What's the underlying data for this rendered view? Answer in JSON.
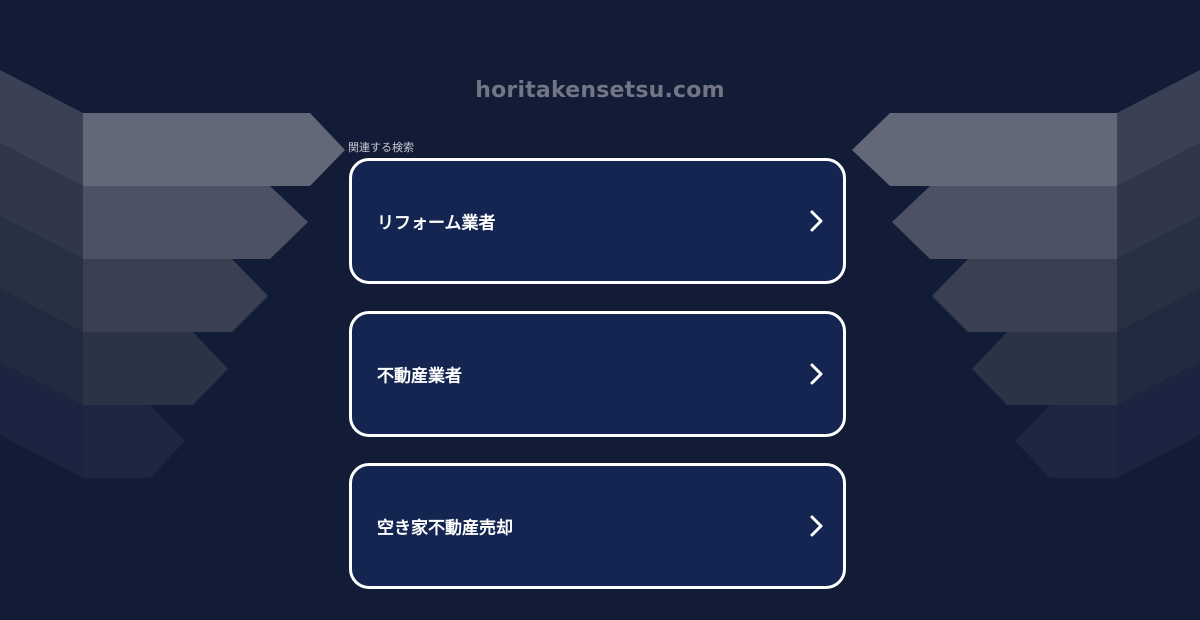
{
  "header": {
    "domain": "horitakensetsu.com"
  },
  "related": {
    "label": "関連する検索",
    "items": [
      {
        "label": "リフォーム業者"
      },
      {
        "label": "不動産業者"
      },
      {
        "label": "空き家不動産売却"
      }
    ]
  },
  "icons": {
    "chevron": "chevron-right-icon"
  },
  "colors": {
    "background": "#121c37",
    "card": "#132550",
    "card_border": "#ffffff",
    "domain_text": "#717684"
  }
}
